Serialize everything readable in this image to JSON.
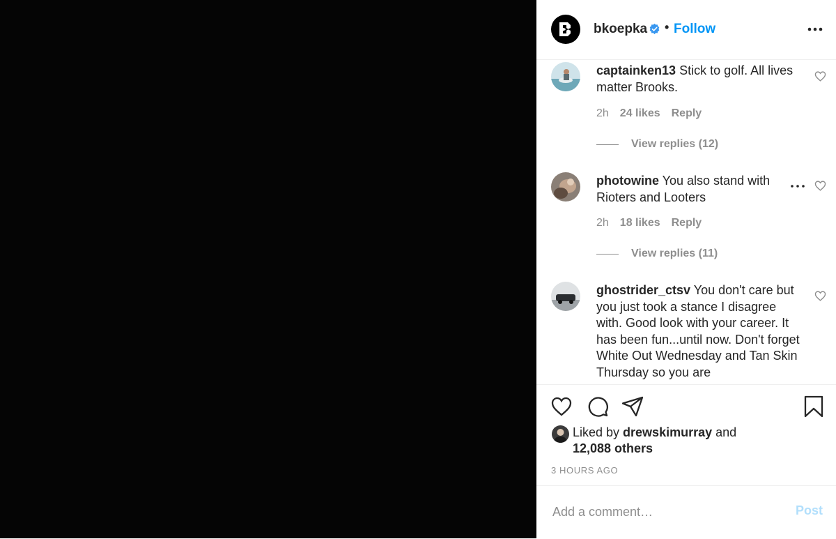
{
  "header": {
    "username": "bkoepka",
    "separator": "•",
    "follow_label": "Follow"
  },
  "comments": [
    {
      "username": "captainken13",
      "text": " Stick to golf. All lives matter Brooks.",
      "time": "2h",
      "likes": "24 likes",
      "reply_label": "Reply",
      "view_replies": "View replies (12)"
    },
    {
      "username": "photowine",
      "text": " You also stand with Rioters and Looters",
      "time": "2h",
      "likes": "18 likes",
      "reply_label": "Reply",
      "view_replies": "View replies (11)"
    },
    {
      "username": "ghostrider_ctsv",
      "text": " You don't care but you just took a stance I disagree with. Good look with your career. It has been fun...until now. Don't forget White Out Wednesday and Tan Skin Thursday so you are"
    }
  ],
  "likes": {
    "prefix": "Liked by ",
    "user": "drewskimurray",
    "suffix": " and",
    "others": "12,088 others"
  },
  "time_ago": "3 HOURS AGO",
  "add_comment": {
    "placeholder": "Add a comment…",
    "post_label": "Post"
  },
  "colors": {
    "follow": "#0095f6",
    "post_disabled": "#b2dffc",
    "media_bg": "#050505",
    "muted_text": "#8e8e8e"
  },
  "icons": [
    "verified-badge-icon",
    "more-options-icon",
    "heart-icon",
    "comment-icon",
    "share-icon",
    "bookmark-icon"
  ]
}
